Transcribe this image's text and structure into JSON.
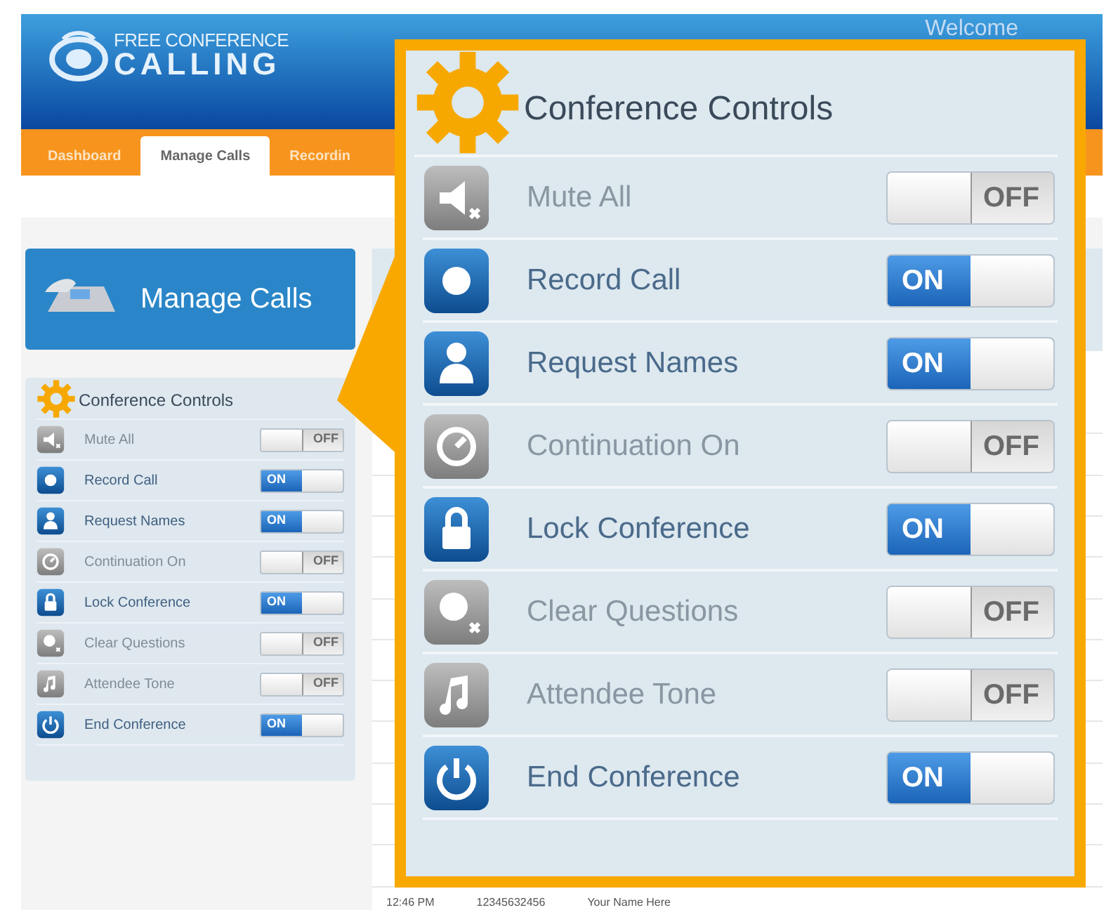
{
  "header": {
    "logo_top": "FREE CONFERENCE",
    "logo_bottom": "CALLING",
    "welcome": "Welcome"
  },
  "nav": {
    "tabs": [
      {
        "label": "Dashboard",
        "selected": false
      },
      {
        "label": "Manage Calls",
        "selected": true
      },
      {
        "label": "Recordin",
        "selected": false
      }
    ]
  },
  "sidebar": {
    "title": "Manage Calls",
    "panel_title": "Conference Controls",
    "controls": [
      {
        "label": "Mute All",
        "on": false,
        "toggle": "OFF"
      },
      {
        "label": "Record Call",
        "on": true,
        "toggle": "ON"
      },
      {
        "label": "Request Names",
        "on": true,
        "toggle": "ON"
      },
      {
        "label": "Continuation On",
        "on": false,
        "toggle": "OFF"
      },
      {
        "label": "Lock Conference",
        "on": true,
        "toggle": "ON"
      },
      {
        "label": "Clear Questions",
        "on": false,
        "toggle": "OFF"
      },
      {
        "label": "Attendee Tone",
        "on": false,
        "toggle": "OFF"
      },
      {
        "label": "End Conference",
        "on": true,
        "toggle": "ON"
      }
    ]
  },
  "table": {
    "last_row": {
      "time": "12:46 PM",
      "number": "12345632456",
      "name": "Your Name Here"
    }
  },
  "callout": {
    "title": "Conference Controls",
    "controls": [
      {
        "label": "Mute All",
        "on": false,
        "toggle": "OFF"
      },
      {
        "label": "Record Call",
        "on": true,
        "toggle": "ON"
      },
      {
        "label": "Request Names",
        "on": true,
        "toggle": "ON"
      },
      {
        "label": "Continuation On",
        "on": false,
        "toggle": "OFF"
      },
      {
        "label": "Lock Conference",
        "on": true,
        "toggle": "ON"
      },
      {
        "label": "Clear Questions",
        "on": false,
        "toggle": "OFF"
      },
      {
        "label": "Attendee Tone",
        "on": false,
        "toggle": "OFF"
      },
      {
        "label": "End Conference",
        "on": true,
        "toggle": "ON"
      }
    ]
  }
}
